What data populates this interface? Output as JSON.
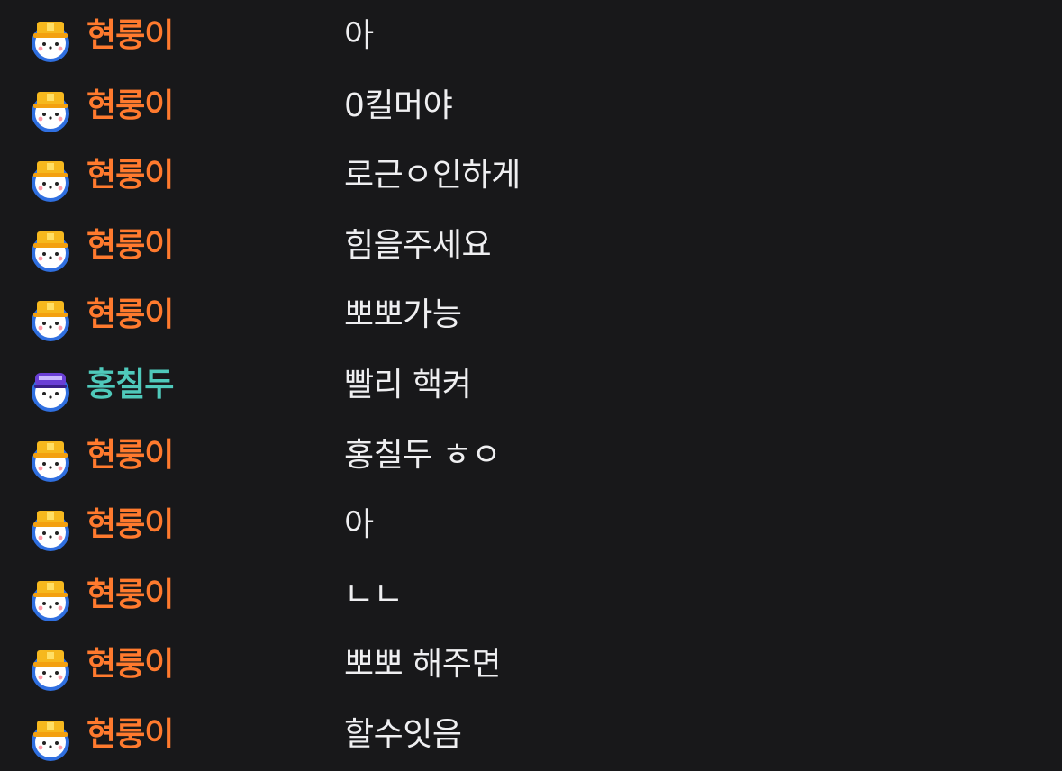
{
  "colors": {
    "background": "#18181a",
    "message_text": "#efeff1"
  },
  "messages": [
    {
      "user": "현룽이",
      "color": "#ff7a2e",
      "avatar": "cat-hardhat-icon",
      "text": "아"
    },
    {
      "user": "현룽이",
      "color": "#ff7a2e",
      "avatar": "cat-hardhat-icon",
      "text": "0킬머야"
    },
    {
      "user": "현룽이",
      "color": "#ff7a2e",
      "avatar": "cat-hardhat-icon",
      "text": "로근ㅇ인하게"
    },
    {
      "user": "현룽이",
      "color": "#ff7a2e",
      "avatar": "cat-hardhat-icon",
      "text": "힘을주세요"
    },
    {
      "user": "현룽이",
      "color": "#ff7a2e",
      "avatar": "cat-hardhat-icon",
      "text": "뽀뽀가능"
    },
    {
      "user": "홍칠두",
      "color": "#4fc9bb",
      "avatar": "cat-purple-hat-icon",
      "text": "빨리 핵켜"
    },
    {
      "user": "현룽이",
      "color": "#ff7a2e",
      "avatar": "cat-hardhat-icon",
      "text": "홍칠두 ㅎㅇ"
    },
    {
      "user": "현룽이",
      "color": "#ff7a2e",
      "avatar": "cat-hardhat-icon",
      "text": "아"
    },
    {
      "user": "현룽이",
      "color": "#ff7a2e",
      "avatar": "cat-hardhat-icon",
      "text": "ㄴㄴ"
    },
    {
      "user": "현룽이",
      "color": "#ff7a2e",
      "avatar": "cat-hardhat-icon",
      "text": "뽀뽀 해주면"
    },
    {
      "user": "현룽이",
      "color": "#ff7a2e",
      "avatar": "cat-hardhat-icon",
      "text": "할수잇음"
    }
  ]
}
